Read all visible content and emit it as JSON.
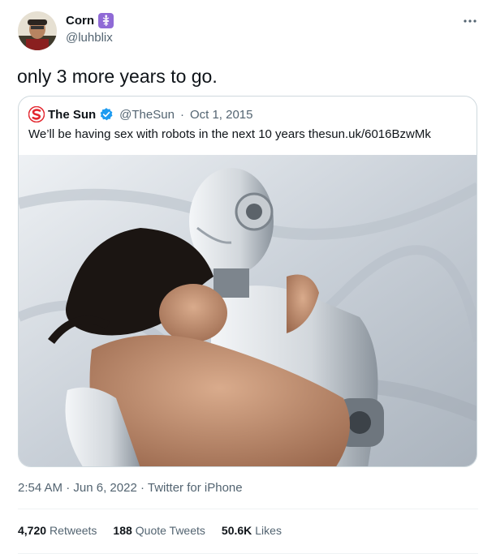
{
  "author": {
    "display_name": "Corn",
    "handle": "@luhblix",
    "badge_icon": "caduceus-icon"
  },
  "tweet": {
    "text": "only 3 more years to go."
  },
  "quote": {
    "display_name": "The Sun",
    "handle": "@TheSun",
    "separator": "·",
    "date": "Oct 1, 2015",
    "text": "We’ll be having sex with robots in the next 10 years thesun.uk/6016BzwMk"
  },
  "meta": {
    "time": "2:54 AM",
    "date": "Jun 6, 2022",
    "client": "Twitter for iPhone",
    "separator": "·"
  },
  "stats": [
    {
      "value": "4,720",
      "label": "Retweets"
    },
    {
      "value": "188",
      "label": "Quote Tweets"
    },
    {
      "value": "50.6K",
      "label": "Likes"
    }
  ],
  "colors": {
    "text": "#0f1419",
    "secondary": "#536471",
    "verified": "#1d9bf0",
    "sun_red": "#e3262e",
    "badge": "#8f6ad6"
  }
}
